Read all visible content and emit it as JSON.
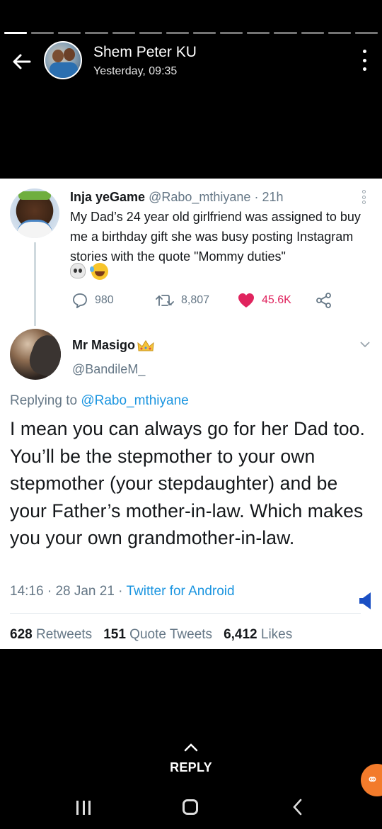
{
  "header": {
    "contact_name": "Shem Peter KU",
    "timestamp": "Yesterday, 09:35",
    "progress_segments": 14,
    "progress_done": 1
  },
  "tweet_original": {
    "display_name": "Inja yeGame",
    "handle": "@Rabo_mthiyane",
    "separator": " · ",
    "age": "21h",
    "text": "My Dad’s 24 year old girlfriend was assigned to buy me a birthday gift she was busy posting Instagram stories with the quote \"Mommy duties\"",
    "emojis": [
      "skull-emoji",
      "joy-emoji"
    ],
    "replies": "980",
    "retweets": "8,807",
    "likes": "45.6K"
  },
  "tweet_reply": {
    "display_name": "Mr Masigo",
    "handle": "@BandileM_",
    "replying_prefix": "Replying to ",
    "replying_handle": "@Rabo_mthiyane",
    "text": "I mean you can always go for her Dad too. You’ll be the stepmother to your own stepmother (your stepdaughter) and be your Father’s mother-in-law. Which makes you your own grandmother-in-law.",
    "time": "14:16",
    "date_sep": " · ",
    "date": "28 Jan 21",
    "source_sep": " · ",
    "source": "Twitter for Android",
    "stats": {
      "retweets_count": "628",
      "retweets_label": " Retweets",
      "quotes_count": "151",
      "quotes_label": " Quote Tweets",
      "likes_count": "6,412",
      "likes_label": " Likes"
    }
  },
  "bottom": {
    "reply_label": "REPLY"
  },
  "colors": {
    "twitter_blue": "#1b95e0",
    "like_red": "#e0245e",
    "muted": "#657786",
    "fab_orange": "#f37b2b"
  }
}
